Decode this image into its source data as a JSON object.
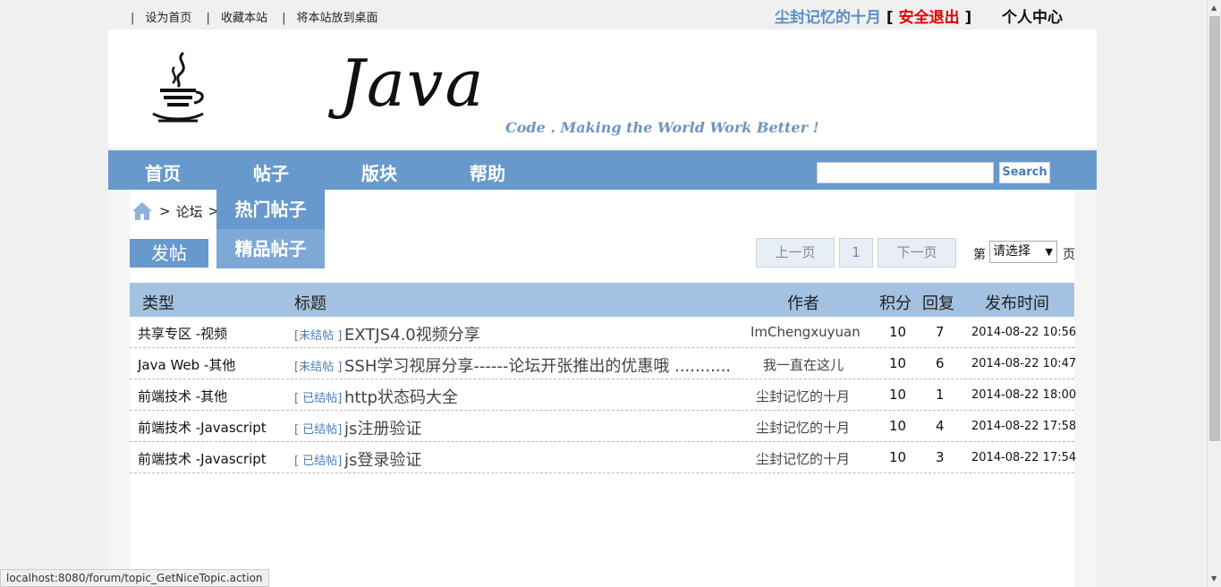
{
  "top_links": [
    "设为首页",
    "收藏本站",
    "将本站放到桌面"
  ],
  "user": {
    "name": "尘封记忆的十月",
    "logout_label": "安全退出",
    "center_label": "个人中心"
  },
  "banner": {
    "title": "Java",
    "slogan": "Code . Making the World Work Better !"
  },
  "nav": {
    "items": [
      "首页",
      "帖子",
      "版块",
      "帮助"
    ],
    "search_placeholder": "",
    "search_label": "Search"
  },
  "breadcrumb": {
    "separator": ">",
    "forum": "论坛"
  },
  "dropdown": [
    "热门帖子",
    "精品帖子"
  ],
  "post_button": "发帖",
  "pager": {
    "prev": "上一页",
    "current": "1",
    "next": "下一页",
    "prefix": "第",
    "select_value": "请选择",
    "suffix": "页"
  },
  "table": {
    "headers": [
      "类型",
      "标题",
      "作者",
      "积分",
      "回复",
      "发布时间"
    ],
    "rows": [
      {
        "type": "共享专区 -视频",
        "tag": "[未结帖 ]",
        "title": "EXTJS4.0视频分享",
        "author": "ImChengxuyuan",
        "points": "10",
        "replies": "7",
        "time": "2014-08-22 10:56"
      },
      {
        "type": "Java Web -其他",
        "tag": "[未结帖 ]",
        "title": "SSH学习视屏分享------论坛开张推出的优惠哦 ...........",
        "author": "我一直在这儿",
        "points": "10",
        "replies": "6",
        "time": "2014-08-22 10:47"
      },
      {
        "type": "前端技术 -其他",
        "tag": "[ 已结帖]",
        "title": "http状态码大全",
        "author": "尘封记忆的十月",
        "points": "10",
        "replies": "1",
        "time": "2014-08-22 18:00"
      },
      {
        "type": "前端技术 -Javascript",
        "tag": "[ 已结帖]",
        "title": "js注册验证",
        "author": "尘封记忆的十月",
        "points": "10",
        "replies": "4",
        "time": "2014-08-22 17:58"
      },
      {
        "type": "前端技术 -Javascript",
        "tag": "[ 已结帖]",
        "title": "js登录验证",
        "author": "尘封记忆的十月",
        "points": "10",
        "replies": "3",
        "time": "2014-08-22 17:54"
      }
    ]
  },
  "status_url": "localhost:8080/forum/topic_GetNiceTopic.action",
  "colors": {
    "nav_blue": "#6899cc",
    "header_blue": "#a3c1e0",
    "logout_red": "#e00000",
    "username_blue": "#5a8fc8"
  }
}
